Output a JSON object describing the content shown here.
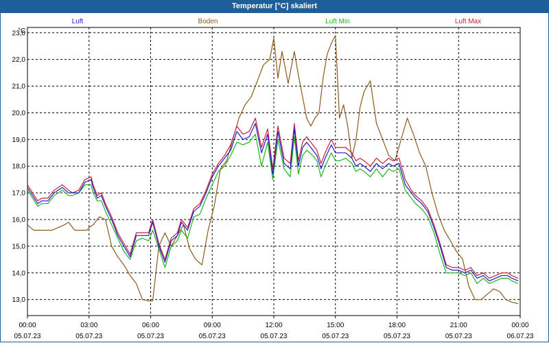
{
  "window": {
    "title": "Temperatur [°C] skaliert"
  },
  "chart_data": {
    "type": "line",
    "title": "Temperatur [°C] skaliert",
    "ylabel": "°C",
    "xlabel": "",
    "grid": true,
    "legend": "top",
    "xlim": [
      0,
      24
    ],
    "ylim": [
      12.4,
      23.2
    ],
    "y_ticks": [
      "23,0",
      "22,0",
      "21,0",
      "20,0",
      "19,0",
      "18,0",
      "17,0",
      "16,0",
      "15,0",
      "14,0",
      "13,0"
    ],
    "x_ticks": [
      {
        "time": "00:00",
        "date": "05.07.23"
      },
      {
        "time": "03:00",
        "date": "05.07.23"
      },
      {
        "time": "06:00",
        "date": "05.07.23"
      },
      {
        "time": "09:00",
        "date": "05.07.23"
      },
      {
        "time": "12:00",
        "date": "05.07.23"
      },
      {
        "time": "15:00",
        "date": "05.07.23"
      },
      {
        "time": "18:00",
        "date": "05.07.23"
      },
      {
        "time": "21:00",
        "date": "05.07.23"
      },
      {
        "time": "00:00",
        "date": "06.07.23"
      }
    ],
    "series": [
      {
        "name": "Luft",
        "color": "#1c1cc8",
        "x": [
          0,
          0.5,
          0.7,
          1.0,
          1.3,
          1.7,
          2.0,
          2.2,
          2.5,
          2.8,
          3.1,
          3.2,
          3.4,
          3.6,
          3.8,
          4.1,
          4.4,
          4.7,
          5.0,
          5.3,
          5.6,
          5.9,
          6.1,
          6.4,
          6.7,
          7.0,
          7.3,
          7.5,
          7.8,
          8.1,
          8.4,
          8.7,
          9.0,
          9.3,
          9.6,
          9.9,
          10.2,
          10.5,
          10.8,
          11.1,
          11.4,
          11.7,
          11.95,
          12.2,
          12.5,
          12.8,
          13.0,
          13.2,
          13.4,
          13.6,
          13.9,
          14.1,
          14.3,
          14.5,
          14.8,
          15.0,
          15.2,
          15.5,
          15.8,
          16.0,
          16.2,
          16.4,
          16.7,
          17.0,
          17.3,
          17.6,
          17.8,
          18.1,
          18.4,
          18.7,
          18.9,
          19.2,
          19.5,
          19.8,
          20.1,
          20.4,
          20.7,
          21.0,
          21.3,
          21.6,
          21.9,
          22.2,
          22.5,
          22.8,
          23.1,
          23.4,
          23.6,
          23.9
        ],
        "y": [
          17.2,
          16.6,
          16.7,
          16.7,
          17.0,
          17.2,
          17.0,
          17.0,
          17.0,
          17.4,
          17.5,
          17.2,
          16.8,
          16.9,
          16.5,
          16.0,
          15.4,
          15.0,
          14.6,
          15.4,
          15.4,
          15.4,
          15.9,
          15.0,
          14.4,
          15.2,
          15.4,
          15.9,
          15.6,
          16.3,
          16.5,
          17.0,
          17.6,
          18.0,
          18.3,
          18.6,
          19.3,
          19.0,
          19.1,
          19.6,
          18.5,
          19.2,
          17.7,
          19.3,
          18.1,
          17.9,
          19.4,
          18.0,
          18.7,
          18.9,
          18.6,
          18.4,
          17.9,
          18.3,
          18.8,
          18.5,
          18.5,
          18.5,
          18.3,
          18.0,
          18.1,
          18.0,
          17.8,
          18.1,
          17.9,
          18.1,
          18.0,
          18.1,
          17.3,
          17.0,
          16.8,
          16.6,
          16.3,
          15.7,
          15.0,
          14.2,
          14.1,
          14.1,
          14.0,
          14.1,
          13.8,
          13.9,
          13.7,
          13.8,
          13.9,
          13.9,
          13.8,
          13.7
        ]
      },
      {
        "name": "Boden",
        "color": "#8b5a1a",
        "x": [
          0,
          0.3,
          0.6,
          0.9,
          1.2,
          1.5,
          1.8,
          2.0,
          2.3,
          2.6,
          2.9,
          3.0,
          3.2,
          3.5,
          3.8,
          4.1,
          4.4,
          4.7,
          5.0,
          5.3,
          5.6,
          5.9,
          6.1,
          6.4,
          6.7,
          7.0,
          7.3,
          7.6,
          7.9,
          8.2,
          8.5,
          8.8,
          9.1,
          9.4,
          9.7,
          10.0,
          10.3,
          10.6,
          10.9,
          11.2,
          11.5,
          11.8,
          12.0,
          12.2,
          12.4,
          12.7,
          13.0,
          13.2,
          13.4,
          13.6,
          13.8,
          14.0,
          14.2,
          14.4,
          14.6,
          14.8,
          15.0,
          15.2,
          15.4,
          15.6,
          15.8,
          16.0,
          16.2,
          16.4,
          16.7,
          17.0,
          17.3,
          17.6,
          17.9,
          18.2,
          18.5,
          18.8,
          19.1,
          19.4,
          19.7,
          20.0,
          20.3,
          20.6,
          20.9,
          21.2,
          21.5,
          21.8,
          22.1,
          22.4,
          22.7,
          23.0,
          23.3,
          23.6,
          23.9
        ],
        "y": [
          15.8,
          15.6,
          15.6,
          15.6,
          15.6,
          15.7,
          15.8,
          15.9,
          15.6,
          15.6,
          15.6,
          15.7,
          15.8,
          16.1,
          16.0,
          15.0,
          14.6,
          14.3,
          13.9,
          13.6,
          13.0,
          12.95,
          12.95,
          15.0,
          15.5,
          15.0,
          15.4,
          15.8,
          14.9,
          14.5,
          14.3,
          15.6,
          16.5,
          17.9,
          18.2,
          19.0,
          19.8,
          20.3,
          20.6,
          21.2,
          21.8,
          22.0,
          22.8,
          21.3,
          22.3,
          21.1,
          22.3,
          21.4,
          20.6,
          19.8,
          19.5,
          19.8,
          20.0,
          21.3,
          22.2,
          22.6,
          22.9,
          19.8,
          20.3,
          19.5,
          18.3,
          19.0,
          20.2,
          20.8,
          21.2,
          19.6,
          19.0,
          18.4,
          18.2,
          19.0,
          19.8,
          19.2,
          18.5,
          18.0,
          17.0,
          16.2,
          15.6,
          15.2,
          14.8,
          14.5,
          13.5,
          13.0,
          13.0,
          13.2,
          13.4,
          13.3,
          13.0,
          12.9,
          12.85
        ]
      },
      {
        "name": "Luft Min",
        "color": "#1cb41c",
        "x": [
          0,
          0.5,
          0.7,
          1.0,
          1.3,
          1.7,
          2.0,
          2.2,
          2.5,
          2.8,
          3.1,
          3.2,
          3.4,
          3.6,
          3.8,
          4.1,
          4.4,
          4.7,
          5.0,
          5.3,
          5.6,
          5.9,
          6.1,
          6.4,
          6.7,
          7.0,
          7.3,
          7.5,
          7.8,
          8.1,
          8.4,
          8.7,
          9.0,
          9.3,
          9.6,
          9.9,
          10.2,
          10.5,
          10.8,
          11.1,
          11.4,
          11.7,
          11.95,
          12.2,
          12.5,
          12.8,
          13.0,
          13.2,
          13.4,
          13.6,
          13.9,
          14.1,
          14.3,
          14.5,
          14.8,
          15.0,
          15.2,
          15.5,
          15.8,
          16.0,
          16.2,
          16.4,
          16.7,
          17.0,
          17.3,
          17.6,
          17.8,
          18.1,
          18.4,
          18.7,
          18.9,
          19.2,
          19.5,
          19.8,
          20.1,
          20.4,
          20.7,
          21.0,
          21.3,
          21.6,
          21.9,
          22.2,
          22.5,
          22.8,
          23.1,
          23.4,
          23.6,
          23.9
        ],
        "y": [
          17.1,
          16.5,
          16.6,
          16.6,
          16.9,
          17.1,
          16.9,
          16.9,
          17.0,
          17.3,
          17.3,
          17.0,
          16.7,
          16.7,
          16.3,
          15.8,
          15.3,
          14.8,
          14.5,
          15.2,
          15.3,
          15.2,
          15.6,
          14.9,
          14.2,
          15.0,
          15.2,
          15.6,
          15.3,
          16.1,
          16.2,
          16.8,
          17.3,
          17.8,
          18.0,
          18.4,
          18.9,
          18.8,
          18.9,
          19.2,
          18.0,
          18.9,
          17.5,
          19.0,
          17.9,
          17.6,
          19.1,
          17.7,
          18.4,
          18.6,
          18.4,
          18.2,
          17.6,
          18.0,
          18.5,
          18.2,
          18.2,
          18.3,
          18.1,
          17.8,
          17.9,
          17.8,
          17.6,
          17.9,
          17.6,
          17.9,
          17.8,
          17.9,
          17.1,
          16.8,
          16.6,
          16.4,
          16.1,
          15.5,
          14.7,
          14.0,
          14.0,
          14.0,
          13.9,
          14.0,
          13.6,
          13.8,
          13.6,
          13.7,
          13.8,
          13.8,
          13.7,
          13.6
        ]
      },
      {
        "name": "Luft Max",
        "color": "#c81c3c",
        "x": [
          0,
          0.5,
          0.7,
          1.0,
          1.3,
          1.7,
          2.0,
          2.2,
          2.5,
          2.8,
          3.1,
          3.2,
          3.4,
          3.6,
          3.8,
          4.1,
          4.4,
          4.7,
          5.0,
          5.3,
          5.6,
          5.9,
          6.1,
          6.4,
          6.7,
          7.0,
          7.3,
          7.5,
          7.8,
          8.1,
          8.4,
          8.7,
          9.0,
          9.3,
          9.6,
          9.9,
          10.2,
          10.5,
          10.8,
          11.1,
          11.4,
          11.7,
          11.95,
          12.2,
          12.5,
          12.8,
          13.0,
          13.2,
          13.4,
          13.6,
          13.9,
          14.1,
          14.3,
          14.5,
          14.8,
          15.0,
          15.2,
          15.5,
          15.8,
          16.0,
          16.2,
          16.4,
          16.7,
          17.0,
          17.3,
          17.6,
          17.8,
          18.1,
          18.4,
          18.7,
          18.9,
          19.2,
          19.5,
          19.8,
          20.1,
          20.4,
          20.7,
          21.0,
          21.3,
          21.6,
          21.9,
          22.2,
          22.5,
          22.8,
          23.1,
          23.4,
          23.6,
          23.9
        ],
        "y": [
          17.3,
          16.7,
          16.8,
          16.8,
          17.1,
          17.3,
          17.1,
          17.0,
          17.1,
          17.5,
          17.6,
          17.3,
          16.9,
          17.0,
          16.6,
          16.1,
          15.5,
          15.1,
          14.7,
          15.5,
          15.5,
          15.5,
          16.0,
          15.1,
          14.5,
          15.3,
          15.5,
          16.0,
          15.7,
          16.4,
          16.6,
          17.1,
          17.7,
          18.1,
          18.4,
          18.8,
          19.5,
          19.2,
          19.3,
          19.8,
          18.7,
          19.4,
          17.9,
          19.5,
          18.3,
          18.1,
          19.6,
          18.2,
          18.9,
          19.1,
          18.8,
          18.6,
          18.1,
          18.5,
          19.0,
          18.7,
          18.7,
          18.7,
          18.5,
          18.2,
          18.3,
          18.2,
          18.0,
          18.3,
          18.1,
          18.3,
          18.2,
          18.3,
          17.5,
          17.1,
          16.9,
          16.7,
          16.4,
          15.8,
          15.1,
          14.3,
          14.2,
          14.2,
          14.1,
          14.2,
          13.9,
          14.0,
          13.8,
          13.9,
          14.0,
          14.0,
          13.9,
          13.8
        ]
      }
    ]
  }
}
